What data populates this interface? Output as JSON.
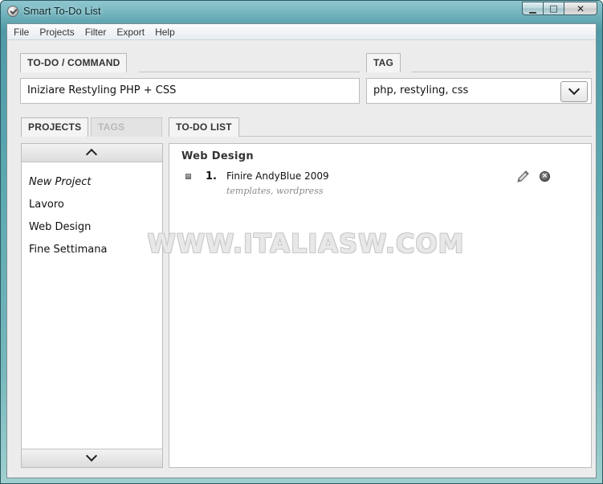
{
  "window": {
    "title": "Smart To-Do List",
    "minimize_label": "▁",
    "maximize_label": "□",
    "close_label": "✕"
  },
  "menu": {
    "items": [
      "File",
      "Projects",
      "Filter",
      "Export",
      "Help"
    ]
  },
  "command": {
    "tab_label": "TO-DO / COMMAND",
    "value": "Iniziare Restyling PHP + CSS"
  },
  "tag": {
    "tab_label": "TAG",
    "value": "php, restyling, css"
  },
  "sidebar": {
    "tabs": [
      {
        "label": "PROJECTS",
        "active": true
      },
      {
        "label": "TAGS",
        "active": false
      }
    ],
    "projects": [
      {
        "label": "New Project",
        "italic": true
      },
      {
        "label": "Lavoro"
      },
      {
        "label": "Web Design"
      },
      {
        "label": "Fine Settimana"
      }
    ]
  },
  "todo": {
    "tab_label": "TO-DO LIST",
    "group_title": "Web Design",
    "items": [
      {
        "number": "1.",
        "title": "Finire AndyBlue 2009",
        "tags": "templates, wordpress"
      }
    ]
  },
  "watermark": "WWW.ITALIASW.COM",
  "icons": {
    "edit": "pencil-icon",
    "delete": "delete-circle-icon",
    "scroll_up": "chevron-up-icon",
    "scroll_down": "chevron-down-icon",
    "dropdown": "chevron-down-icon"
  }
}
